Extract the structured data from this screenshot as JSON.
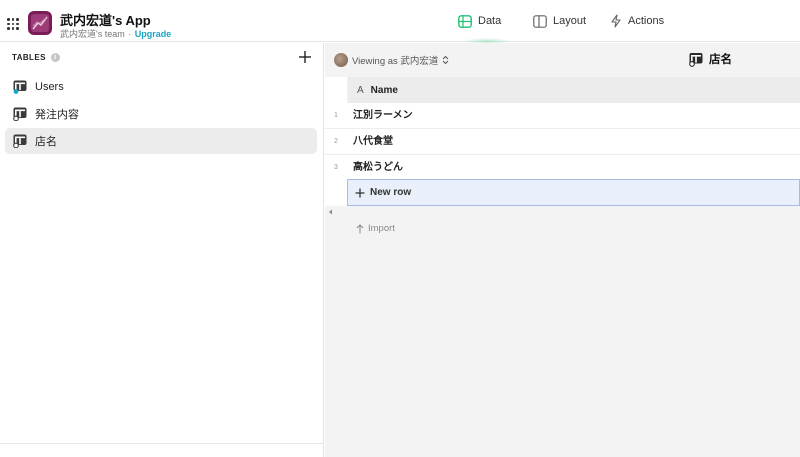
{
  "app": {
    "title": "武内宏道's App",
    "team": "武内宏道's team",
    "separator": "·",
    "upgrade": "Upgrade",
    "icon_color": "#7a1d56"
  },
  "nav": {
    "data": {
      "label": "Data",
      "icon": "table-icon",
      "color": "#1fbf74",
      "active": true
    },
    "layout": {
      "label": "Layout",
      "icon": "layout-icon"
    },
    "actions": {
      "label": "Actions",
      "icon": "bolt-icon"
    }
  },
  "sidebar": {
    "header": "TABLES",
    "info_glyph": "i",
    "tables": [
      {
        "label": "Users",
        "selected": false
      },
      {
        "label": "発注内容",
        "selected": false
      },
      {
        "label": "店名",
        "selected": true
      }
    ]
  },
  "main": {
    "viewing": "Viewing as 武内宏道",
    "table_title": "店名",
    "column": {
      "type_glyph": "A",
      "name": "Name"
    },
    "rows": [
      {
        "num": "1",
        "name": "江別ラーメン"
      },
      {
        "num": "2",
        "name": "八代食堂"
      },
      {
        "num": "3",
        "name": "高松うどん"
      }
    ],
    "new_row": "New row",
    "import": "Import",
    "selection_color": "#a9b9e8"
  }
}
